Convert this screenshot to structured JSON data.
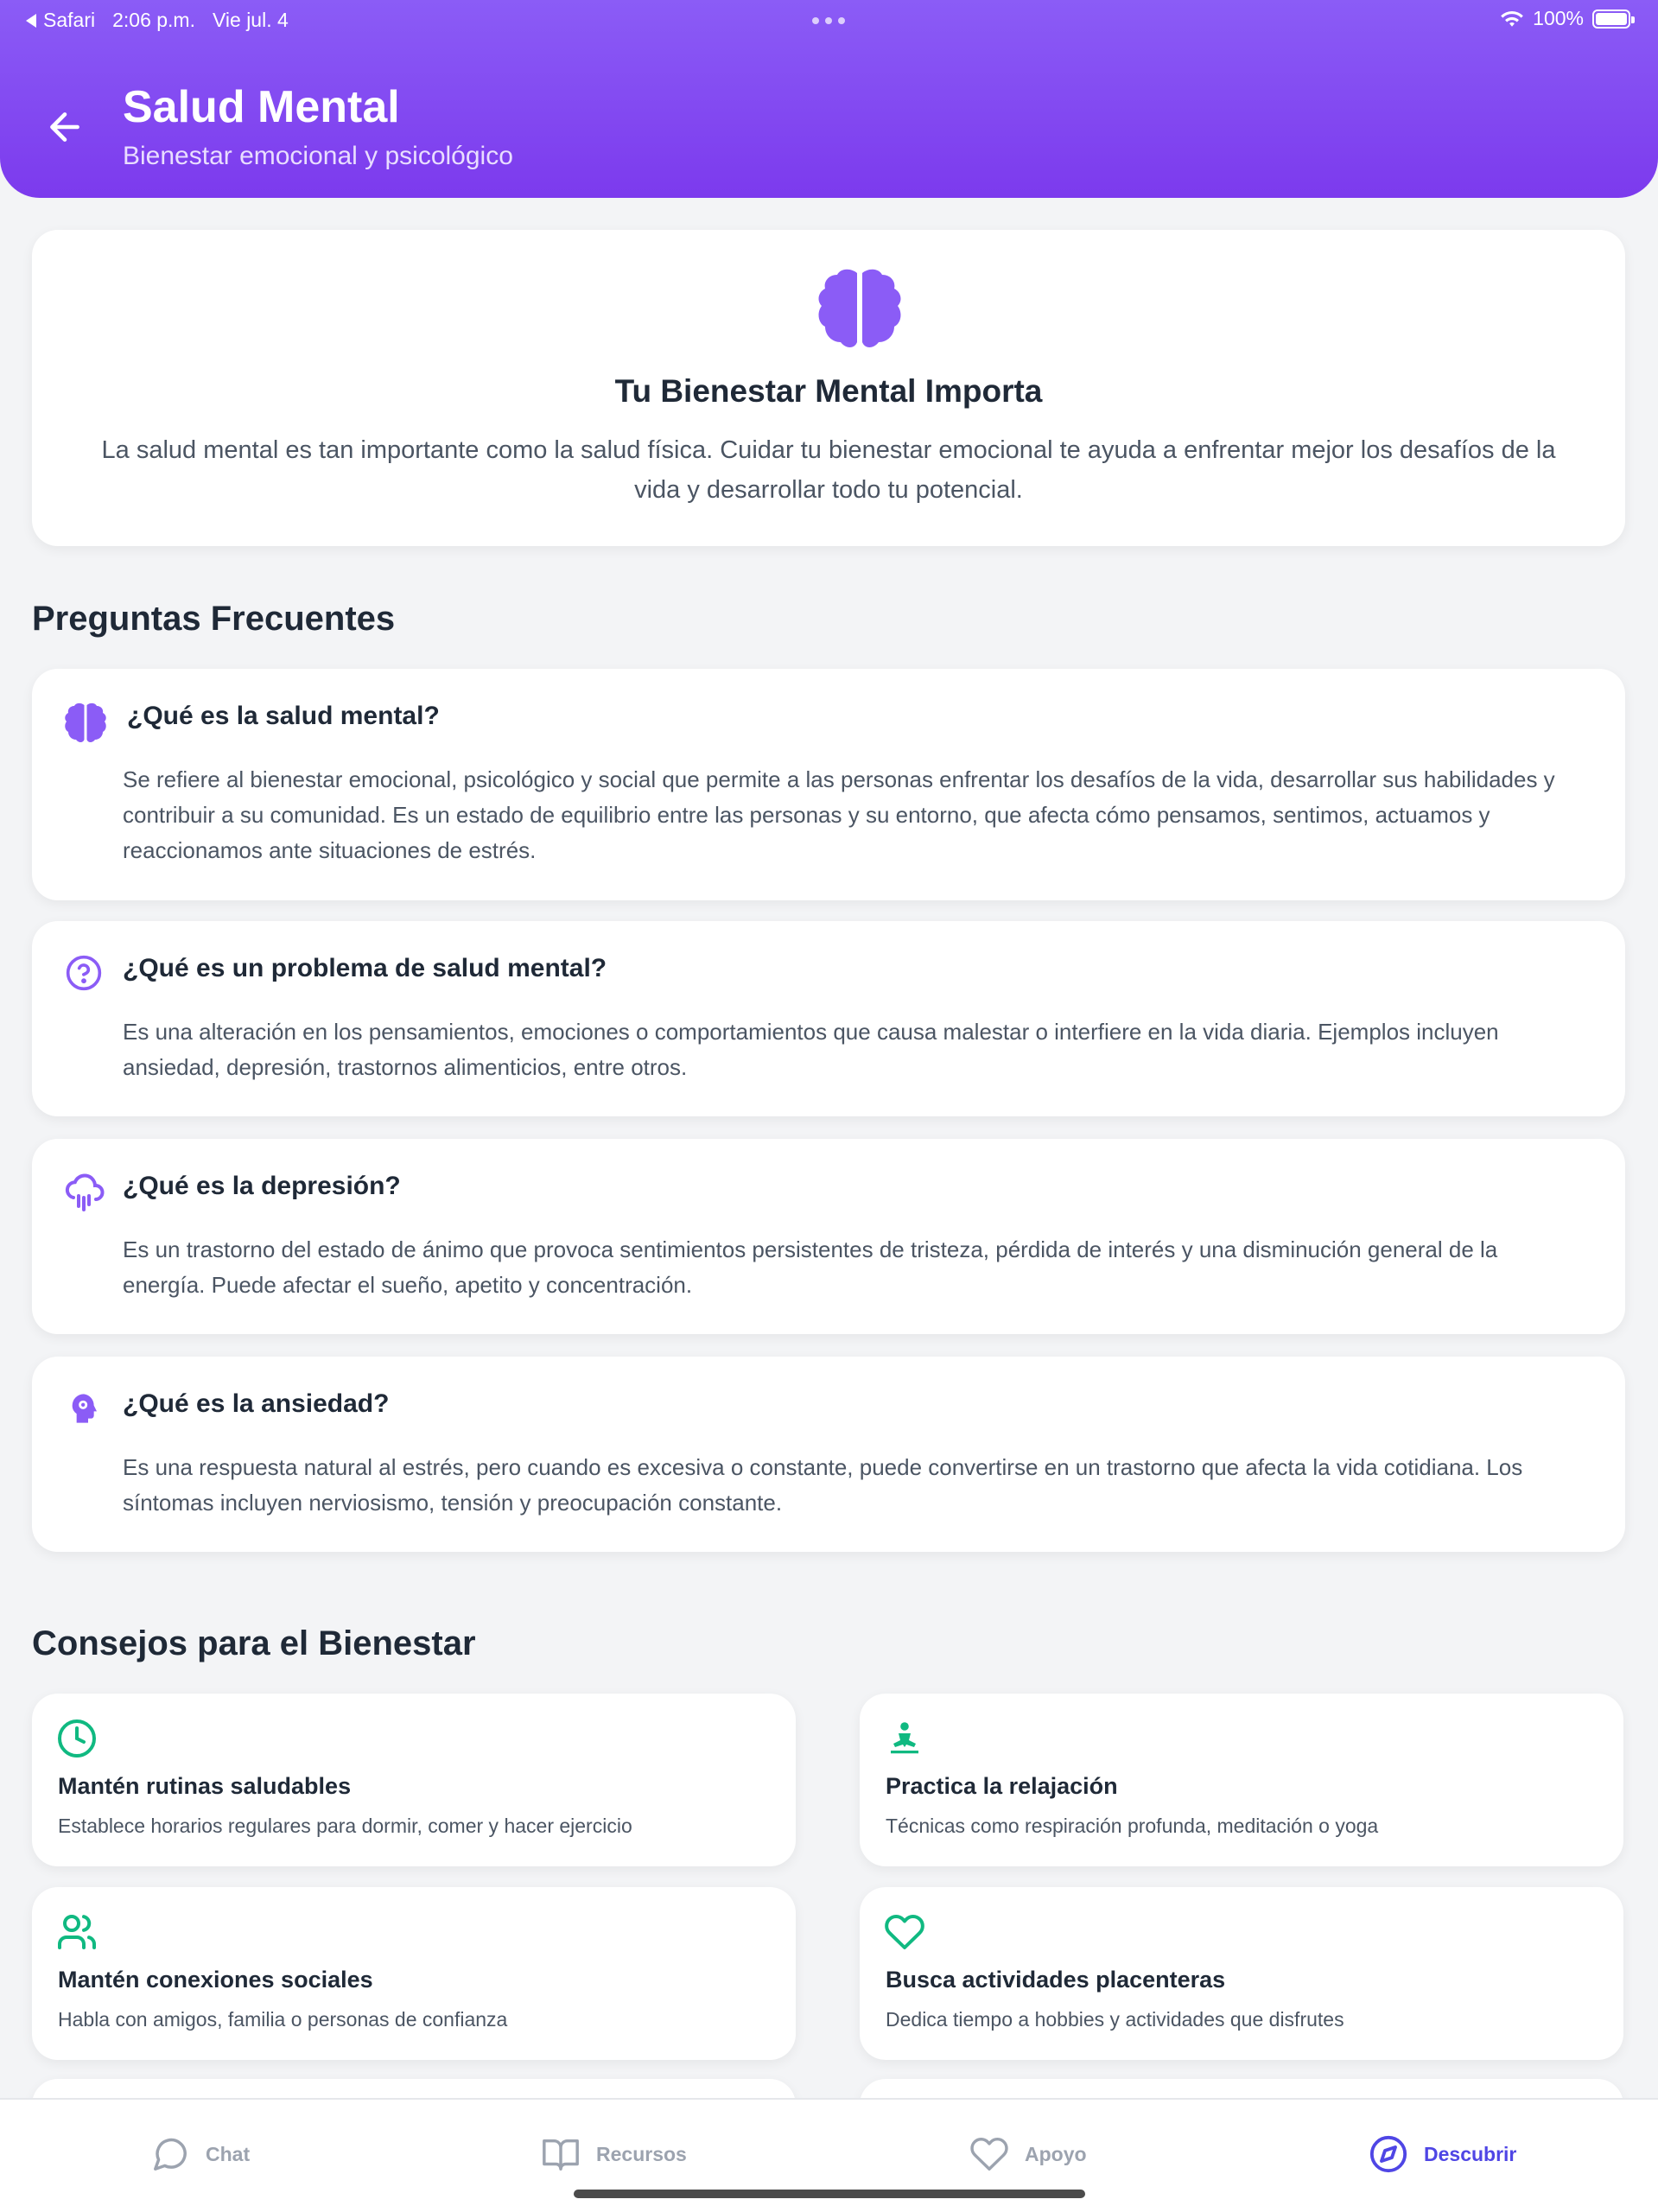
{
  "status_bar": {
    "app": "Safari",
    "time": "2:06 p.m.",
    "date": "Vie jul. 4",
    "battery": "100%"
  },
  "header": {
    "title": "Salud Mental",
    "subtitle": "Bienestar emocional y psicológico"
  },
  "hero": {
    "title": "Tu Bienestar Mental Importa",
    "text": "La salud mental es tan importante como la salud física. Cuidar tu bienestar emocional te ayuda a enfrentar mejor los desafíos de la vida y desarrollar todo tu potencial.",
    "icon": "brain-icon"
  },
  "faq": {
    "section_title": "Preguntas Frecuentes",
    "items": [
      {
        "icon": "brain-icon",
        "question": "¿Qué es la salud mental?",
        "answer": "Se refiere al bienestar emocional, psicológico y social que permite a las personas enfrentar los desafíos de la vida, desarrollar sus habilidades y contribuir a su comunidad. Es un estado de equilibrio entre las personas y su entorno, que afecta cómo pensamos, sentimos, actuamos y reaccionamos ante situaciones de estrés."
      },
      {
        "icon": "question-circle-icon",
        "question": "¿Qué es un problema de salud mental?",
        "answer": "Es una alteración en los pensamientos, emociones o comportamientos que causa malestar o interfiere en la vida diaria. Ejemplos incluyen ansiedad, depresión, trastornos alimenticios, entre otros."
      },
      {
        "icon": "cloud-rain-icon",
        "question": "¿Qué es la depresión?",
        "answer": "Es un trastorno del estado de ánimo que provoca sentimientos persistentes de tristeza, pérdida de interés y una disminución general de la energía. Puede afectar el sueño, apetito y concentración."
      },
      {
        "icon": "head-gear-icon",
        "question": "¿Qué es la ansiedad?",
        "answer": "Es una respuesta natural al estrés, pero cuando es excesiva o constante, puede convertirse en un trastorno que afecta la vida cotidiana. Los síntomas incluyen nerviosismo, tensión y preocupación constante."
      }
    ]
  },
  "tips": {
    "section_title": "Consejos para el Bienestar",
    "items": [
      {
        "icon": "clock-icon",
        "title": "Mantén rutinas saludables",
        "desc": "Establece horarios regulares para dormir, comer y hacer ejercicio"
      },
      {
        "icon": "meditation-icon",
        "title": "Practica la relajación",
        "desc": "Técnicas como respiración profunda, meditación o yoga"
      },
      {
        "icon": "users-icon",
        "title": "Mantén conexiones sociales",
        "desc": "Habla con amigos, familia o personas de confianza"
      },
      {
        "icon": "heart-icon",
        "title": "Busca actividades placenteras",
        "desc": "Dedica tiempo a hobbies y actividades que disfrutes"
      }
    ]
  },
  "bottom_nav": {
    "items": [
      {
        "icon": "chat-icon",
        "label": "Chat"
      },
      {
        "icon": "book-icon",
        "label": "Recursos"
      },
      {
        "icon": "heart-icon",
        "label": "Apoyo"
      },
      {
        "icon": "compass-icon",
        "label": "Descubrir"
      }
    ],
    "active": "Descubrir"
  },
  "colors": {
    "brand_purple": "#8b5cf6",
    "accent_green": "#10b981",
    "nav_active": "#4f46e5"
  }
}
